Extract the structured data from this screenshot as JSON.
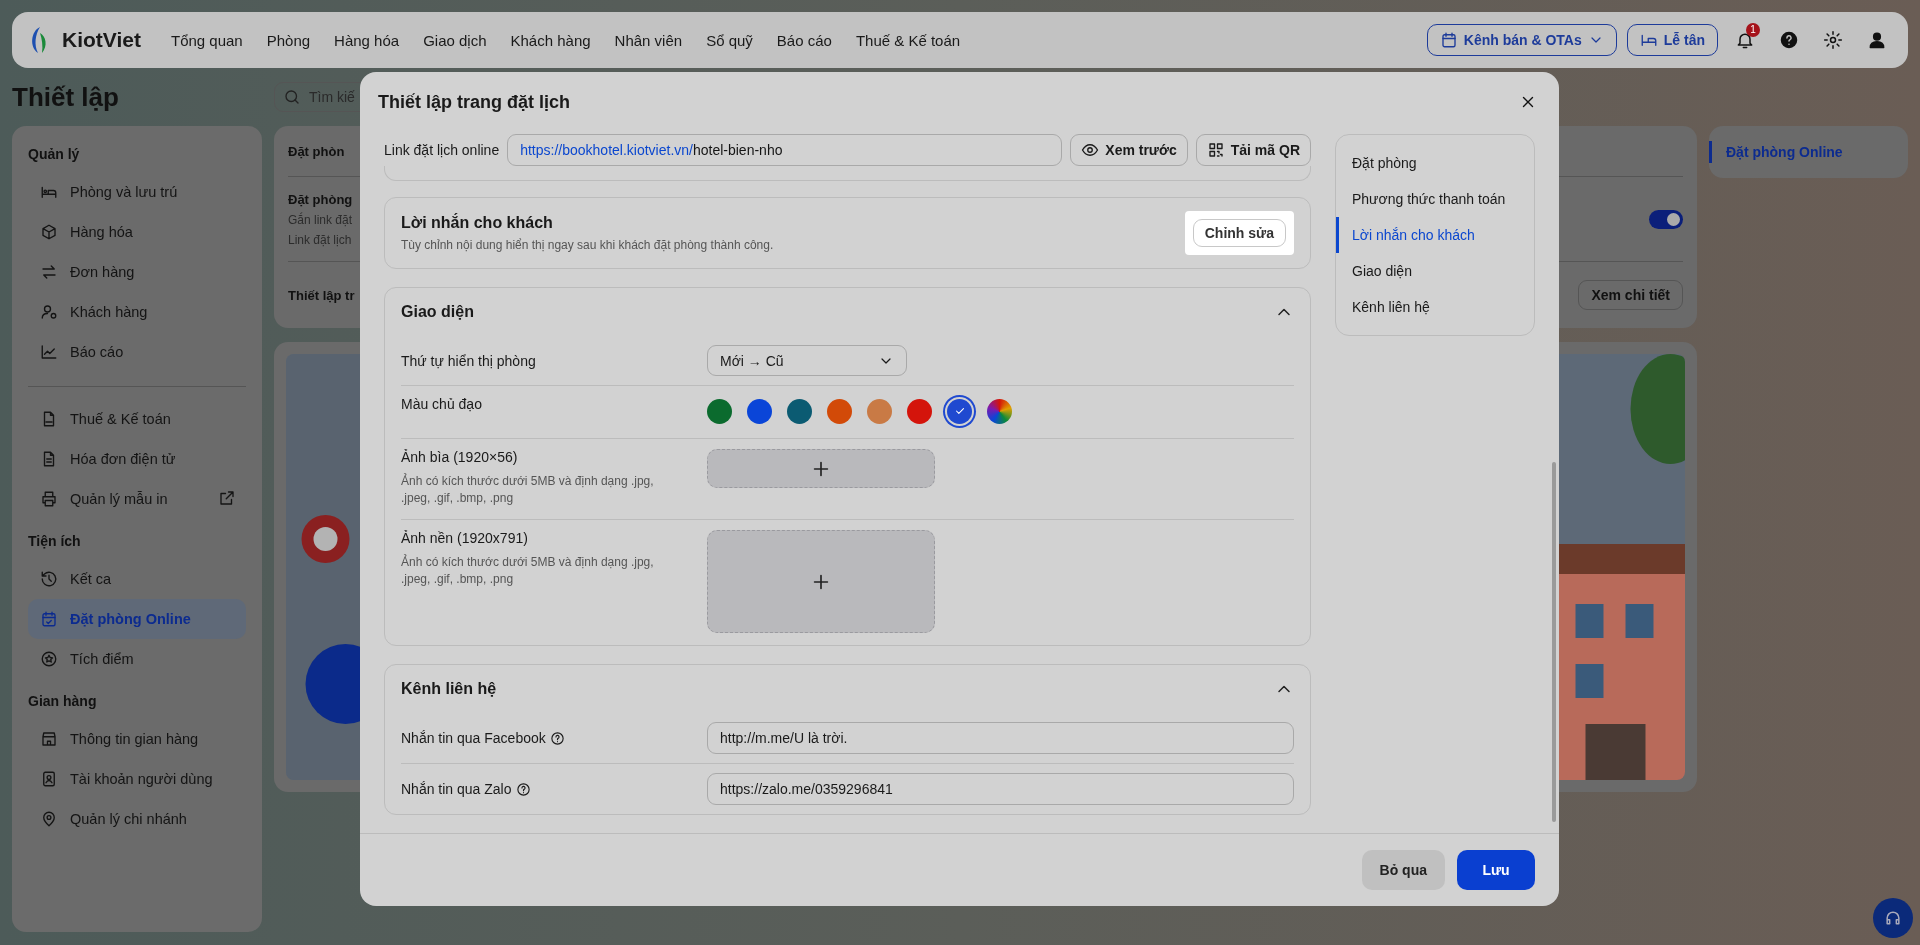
{
  "top_nav": {
    "logo": "KiotViet",
    "items": [
      {
        "label": "Tổng quan"
      },
      {
        "label": "Phòng"
      },
      {
        "label": "Hàng hóa"
      },
      {
        "label": "Giao dịch"
      },
      {
        "label": "Khách hàng"
      },
      {
        "label": "Nhân viên"
      },
      {
        "label": "Sổ quỹ"
      },
      {
        "label": "Báo cáo"
      },
      {
        "label": "Thuế & Kế toán"
      }
    ],
    "channel_button": "Kênh bán & OTAs",
    "reception_button": "Lễ tân",
    "notification_count": "1"
  },
  "page": {
    "title": "Thiết lập",
    "search": {
      "placeholder": "Tìm kiế"
    }
  },
  "sidebar": {
    "sections": [
      {
        "heading": "Quản lý",
        "items": [
          {
            "label": "Phòng và lưu trú",
            "selected": false,
            "external_link": false
          },
          {
            "label": "Hàng hóa",
            "selected": false,
            "external_link": false
          },
          {
            "label": "Đơn hàng",
            "selected": false,
            "external_link": false
          },
          {
            "label": "Khách hàng",
            "selected": false,
            "external_link": false
          },
          {
            "label": "Báo cáo",
            "selected": false,
            "external_link": false
          }
        ]
      },
      {
        "items": [
          {
            "label": "Thuế & Kế toán",
            "selected": false,
            "external_link": false
          },
          {
            "label": "Hóa đơn điện tử",
            "selected": false,
            "external_link": false
          },
          {
            "label": "Quản lý mẫu in",
            "selected": false,
            "external_link": true
          }
        ]
      },
      {
        "heading": "Tiện ích",
        "items": [
          {
            "label": "Kết ca",
            "selected": false,
            "external_link": false
          },
          {
            "label": "Đặt phòng Online",
            "selected": true,
            "external_link": false
          },
          {
            "label": "Tích điểm",
            "selected": false,
            "external_link": false
          }
        ]
      },
      {
        "heading": "Gian hàng",
        "items": [
          {
            "label": "Thông tin gian hàng",
            "selected": false,
            "external_link": false
          },
          {
            "label": "Tài khoản người dùng",
            "selected": false,
            "external_link": false
          },
          {
            "label": "Quản lý chi nhánh",
            "selected": false,
            "external_link": false
          }
        ]
      }
    ]
  },
  "settings_card": {
    "title": "Đặt phòn",
    "booking_title": "Đặt phòng",
    "booking_lines": [
      "Gắn link đặt",
      "Link đặt lịch"
    ],
    "booking_enabled": true,
    "setup_title": "Thiết lập tr",
    "details_button": "Xem chi tiết"
  },
  "side_nav": [
    {
      "label": "Đặt phòng Online",
      "selected": true
    }
  ],
  "modal": {
    "title": "Thiết lập trang đặt lịch",
    "link": {
      "label": "Link đặt lịch online",
      "base": "https://bookhotel.kiotviet.vn/",
      "slug": "hotel-bien-nho"
    },
    "preview_button": "Xem trước",
    "qr_button": "Tải mã QR",
    "message_section": {
      "title": "Lời nhắn cho khách",
      "description": "Tùy chỉnh nội dung hiển thị ngay sau khi khách đặt phòng thành công.",
      "edit_button": "Chỉnh sửa",
      "highlighted": true
    },
    "appearance": {
      "title": "Giao diện",
      "expanded": true,
      "room_order": {
        "label": "Thứ tự hiển thị phòng",
        "value": "Mới → Cũ"
      },
      "theme_color": {
        "label": "Màu chủ đạo",
        "colors": [
          {
            "kind": "swatch",
            "color": "#0b6b2e",
            "selected": false
          },
          {
            "kind": "swatch",
            "color": "#0a45d8",
            "selected": false
          },
          {
            "kind": "swatch",
            "color": "#0b5b72",
            "selected": false
          },
          {
            "kind": "swatch",
            "color": "#d24a08",
            "selected": false
          },
          {
            "kind": "swatch",
            "color": "#c97a45",
            "selected": false
          },
          {
            "kind": "swatch",
            "color": "#d4140b",
            "selected": false
          },
          {
            "kind": "swatch",
            "color": "#1f49d0",
            "selected": true
          },
          {
            "kind": "custom",
            "selected": false
          }
        ]
      },
      "uploads": [
        {
          "label": "Ảnh bìa (1920×56)",
          "hint": "Ảnh có kích thước dưới 5MB và định dạng .jpg, .jpeg, .gif, .bmp, .png",
          "kind": "short"
        },
        {
          "label": "Ảnh nền (1920x791)",
          "hint": "Ảnh có kích thước dưới 5MB và định dạng .jpg, .jpeg, .gif, .bmp, .png",
          "kind": "tall"
        }
      ]
    },
    "contact": {
      "title": "Kênh liên hệ",
      "expanded": true,
      "fields": [
        {
          "label": "Nhắn tin qua Facebook",
          "value": "http://m.me/U là trời."
        },
        {
          "label": "Nhắn tin qua Zalo",
          "value": "https://zalo.me/0359296841"
        }
      ]
    },
    "nav": [
      {
        "label": "Đặt phòng",
        "selected": false
      },
      {
        "label": "Phương thức thanh toán",
        "selected": false
      },
      {
        "label": "Lời nhắn cho khách",
        "selected": true
      },
      {
        "label": "Giao diện",
        "selected": false
      },
      {
        "label": "Kênh liên hệ",
        "selected": false
      }
    ],
    "cancel_button": "Bỏ qua",
    "save_button": "Lưu"
  }
}
